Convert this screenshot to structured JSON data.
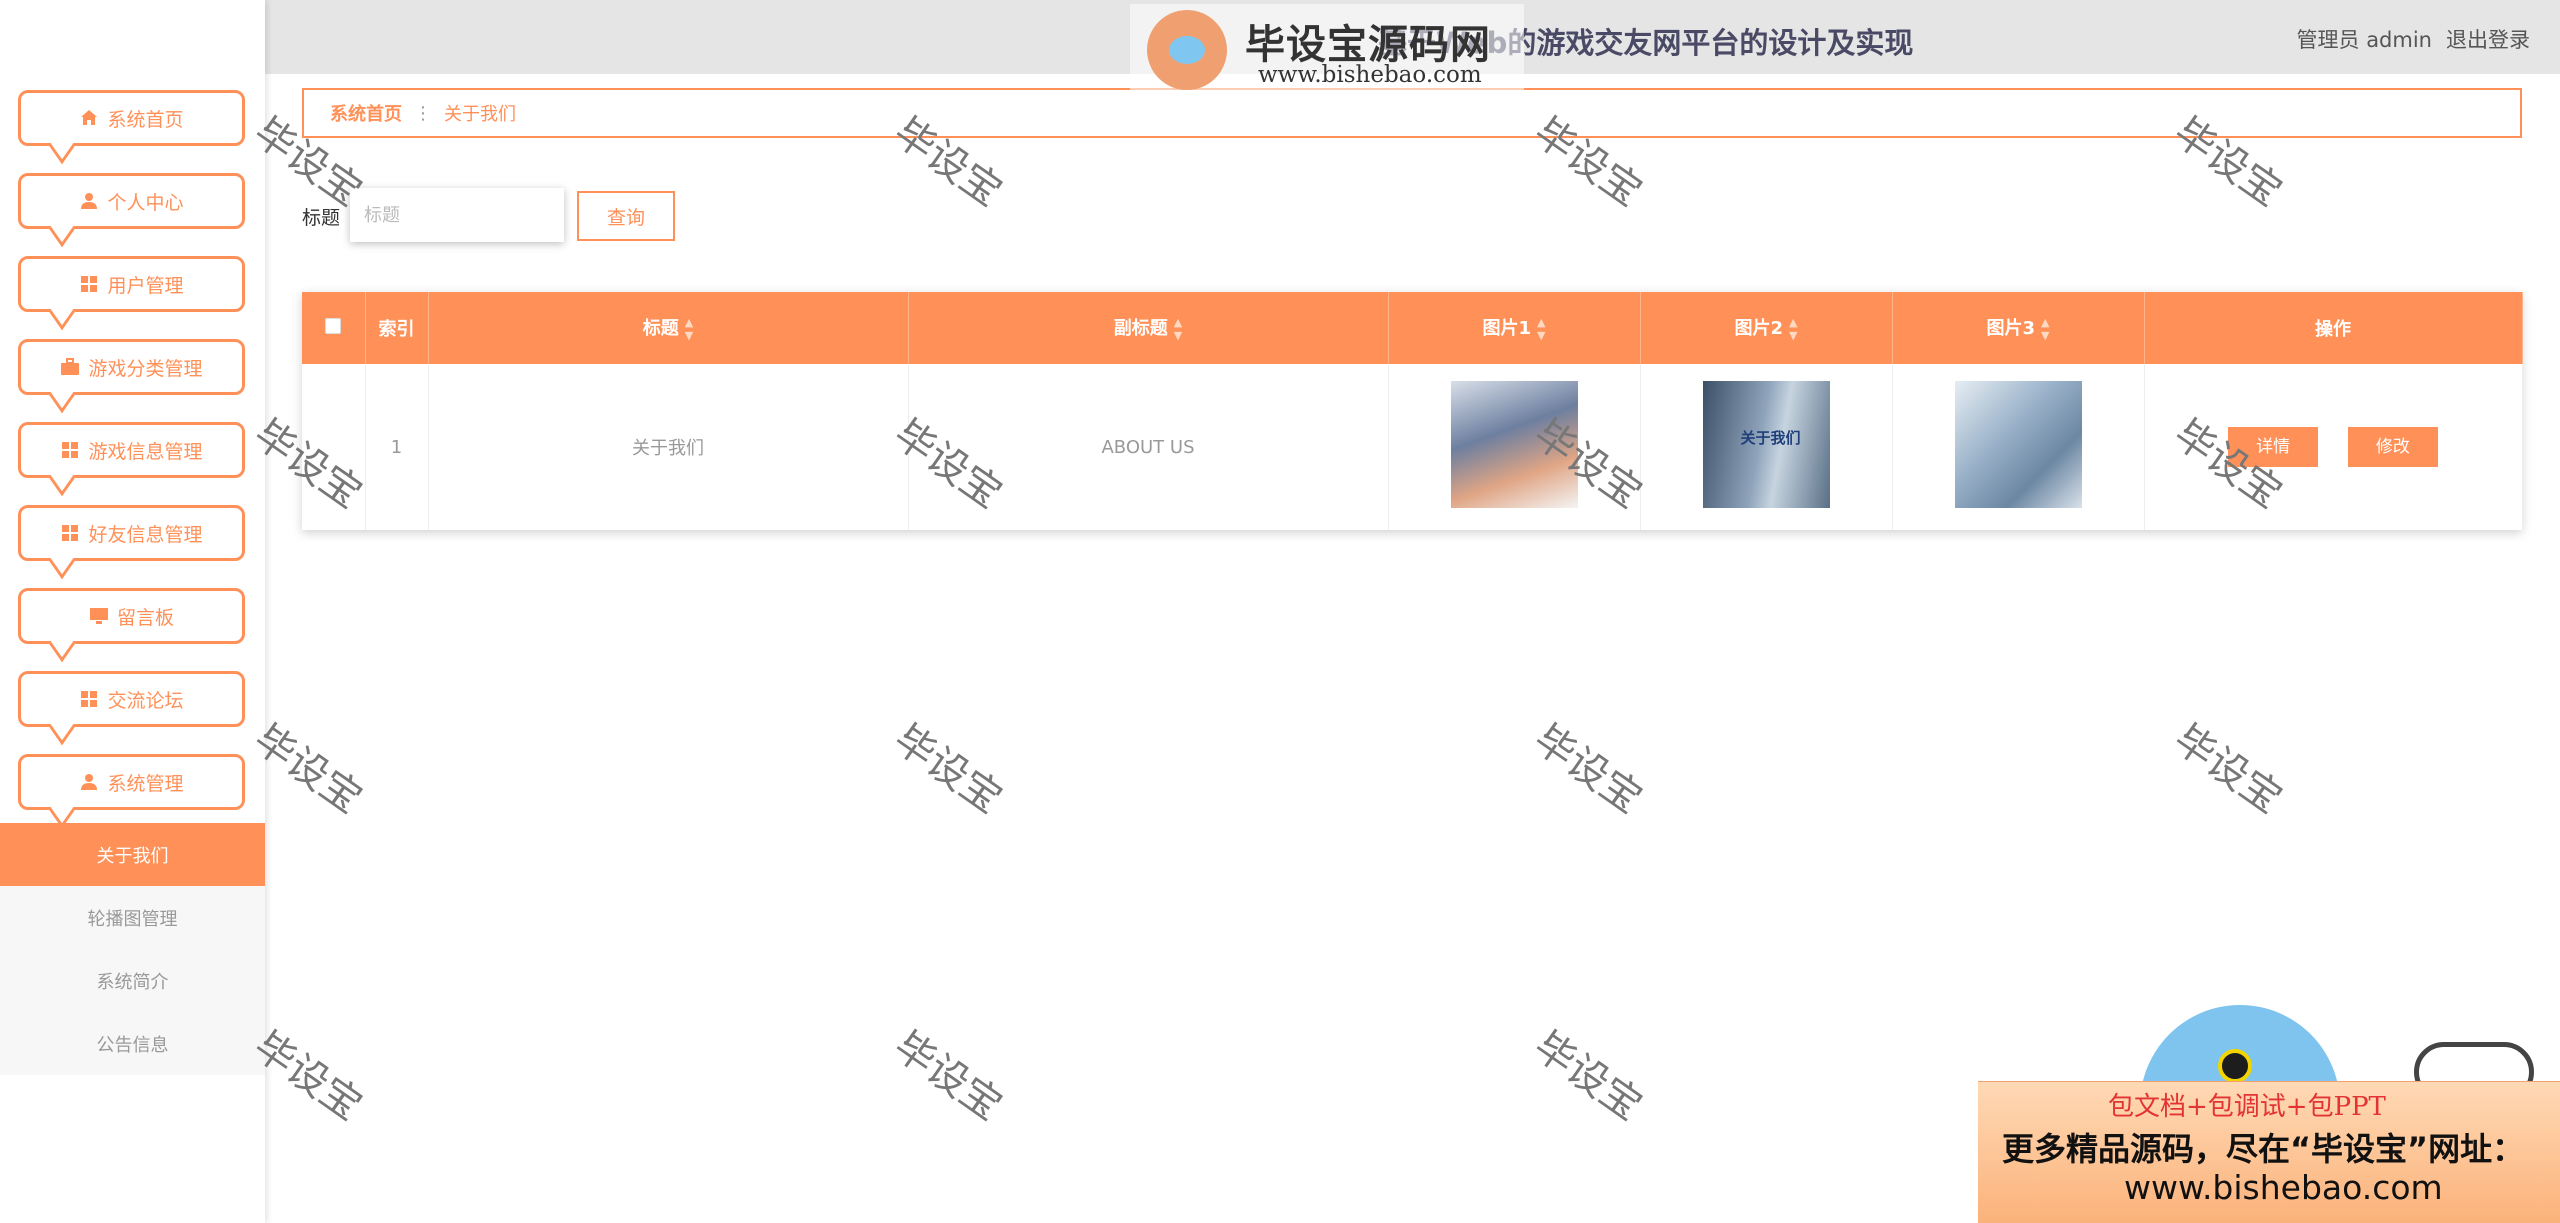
{
  "header": {
    "title": "基于Web的游戏交友网平台的设计及实现",
    "user_label": "管理员 admin",
    "logout_label": "退出登录"
  },
  "logo": {
    "name": "毕设宝源码网",
    "url": "www.bishebao.com"
  },
  "sidebar": {
    "items": [
      {
        "label": "系统首页",
        "icon": "home-icon"
      },
      {
        "label": "个人中心",
        "icon": "user-icon"
      },
      {
        "label": "用户管理",
        "icon": "grid-icon"
      },
      {
        "label": "游戏分类管理",
        "icon": "briefcase-icon"
      },
      {
        "label": "游戏信息管理",
        "icon": "grid-icon"
      },
      {
        "label": "好友信息管理",
        "icon": "grid-icon"
      },
      {
        "label": "留言板",
        "icon": "monitor-icon"
      },
      {
        "label": "交流论坛",
        "icon": "grid-icon"
      },
      {
        "label": "系统管理",
        "icon": "user-icon"
      }
    ],
    "sub_items": [
      {
        "label": "关于我们",
        "active": true
      },
      {
        "label": "轮播图管理",
        "active": false
      },
      {
        "label": "系统简介",
        "active": false
      },
      {
        "label": "公告信息",
        "active": false
      }
    ]
  },
  "breadcrumb": {
    "home": "系统首页",
    "separator": "⋮",
    "current": "关于我们"
  },
  "search": {
    "label": "标题",
    "placeholder": "标题",
    "value": "",
    "button": "查询"
  },
  "table": {
    "columns": [
      "",
      "索引",
      "标题",
      "副标题",
      "图片1",
      "图片2",
      "图片3",
      "操作"
    ],
    "rows": [
      {
        "index": "1",
        "title": "关于我们",
        "subtitle": "ABOUT US",
        "images": [
          "about-image-1",
          "about-image-2",
          "about-image-3"
        ],
        "image2_sign": "关于我们",
        "actions": [
          "详情",
          "修改"
        ]
      }
    ]
  },
  "watermark": "毕设宝",
  "ad": {
    "line1": "包文档+包调试+包PPT",
    "line2": "更多精品源码，尽在“毕设宝”网址：",
    "line3": "www.bishebao.com"
  },
  "colors": {
    "accent": "#ff9158",
    "header_bg": "#e5e5e5"
  }
}
